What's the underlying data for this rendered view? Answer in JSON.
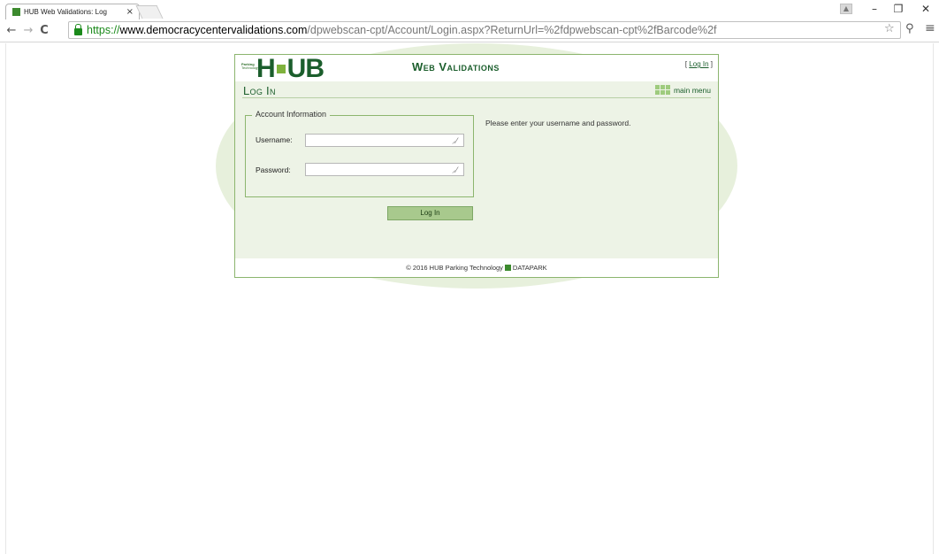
{
  "browser": {
    "tab_title": "HUB Web Validations: Log",
    "tab_close": "×",
    "url": {
      "scheme": "https://",
      "host": "www.democracycentervalidations.com",
      "path": "/dpwebscan-cpt/Account/Login.aspx?ReturnUrl=%2fdpwebscan-cpt%2fBarcode%2f"
    },
    "nav": {
      "back": "←",
      "forward": "→",
      "reload": "C"
    },
    "window": {
      "minimize": "–",
      "maximize": "❐",
      "close": "✕"
    }
  },
  "header": {
    "logo_small_line1": "Parking",
    "logo_small_line2": "Technology",
    "logo_hub_left": "H",
    "logo_hub_right": "UB",
    "app_title": "Web Validations",
    "login_bracket_open": "[ ",
    "login_link": "Log In",
    "login_bracket_close": " ]"
  },
  "section": {
    "title": "Log In",
    "main_menu": "main menu"
  },
  "form": {
    "legend": "Account Information",
    "username_label": "Username:",
    "username_value": "",
    "password_label": "Password:",
    "password_value": "",
    "instructions": "Please enter your username and password.",
    "submit_label": "Log In"
  },
  "footer": {
    "copyright": "© 2016 HUB Parking Technology",
    "brand": "DATAPARK"
  },
  "colors": {
    "brand_dark_green": "#1b5e2c",
    "accent_green": "#7fb23d",
    "panel_bg": "#edf3e6",
    "button_bg": "#a8c98d",
    "secure_green": "#1b8a1b"
  }
}
